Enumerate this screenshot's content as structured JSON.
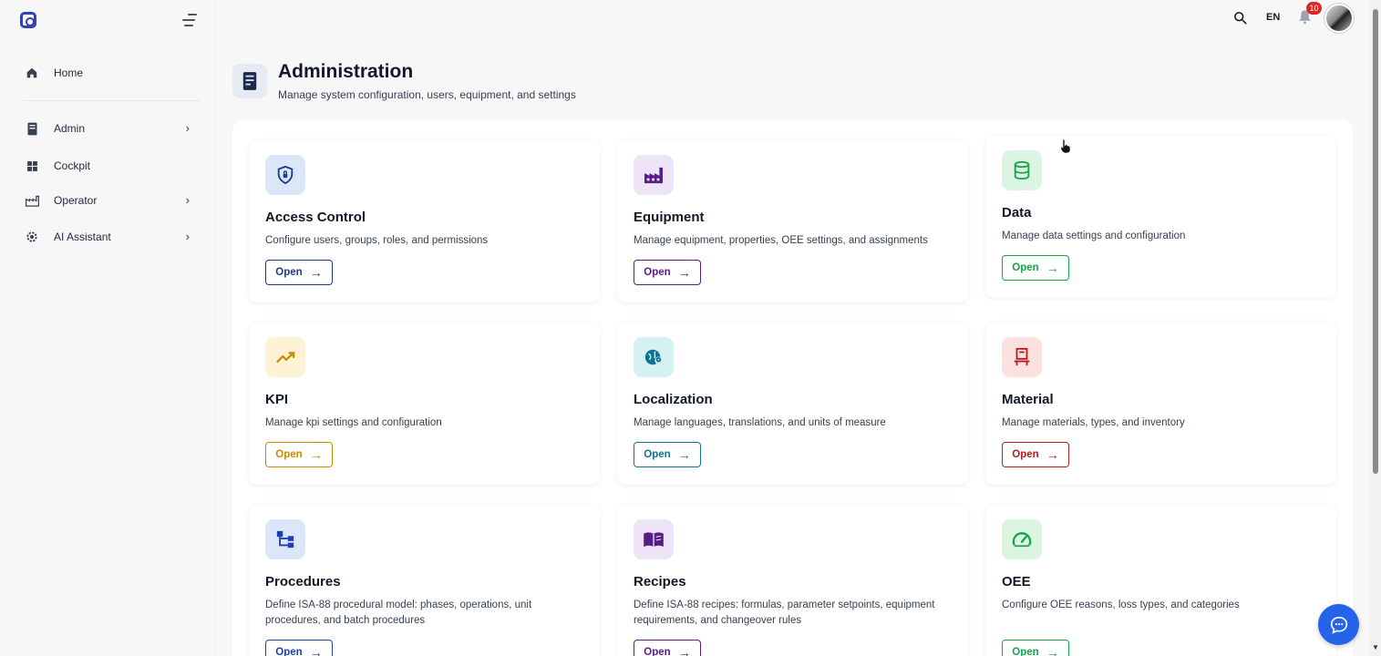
{
  "sidebar": {
    "items": [
      {
        "label": "Home",
        "icon": "home-icon"
      },
      {
        "label": "Admin",
        "icon": "admin-doc-icon",
        "has_children": true
      },
      {
        "label": "Cockpit",
        "icon": "dashboard-icon"
      },
      {
        "label": "Operator",
        "icon": "factory-icon",
        "has_children": true
      },
      {
        "label": "AI Assistant",
        "icon": "gear-icon",
        "has_children": true
      }
    ]
  },
  "topbar": {
    "language": "EN",
    "notifications_count": "10"
  },
  "page": {
    "title": "Administration",
    "subtitle": "Manage system configuration, users, equipment, and settings"
  },
  "cards": [
    {
      "title": "Access Control",
      "description": "Configure users, groups, roles, and permissions",
      "button": "Open",
      "color": "#1e3a8a",
      "bg": "#dbe7f8",
      "icon": "shield-lock-icon"
    },
    {
      "title": "Equipment",
      "description": "Manage equipment, properties, OEE settings, and assignments",
      "button": "Open",
      "color": "#581c87",
      "bg": "#ede4f7",
      "icon": "factory-icon"
    },
    {
      "title": "Data",
      "description": "Manage data settings and configuration",
      "button": "Open",
      "color": "#16a34a",
      "bg": "#dcf5e3",
      "icon": "database-icon"
    },
    {
      "title": "KPI",
      "description": "Manage kpi settings and configuration",
      "button": "Open",
      "color": "#ca8a04",
      "bg": "#fdf3d4",
      "icon": "trending-up-icon"
    },
    {
      "title": "Localization",
      "description": "Manage languages, translations, and units of measure",
      "button": "Open",
      "color": "#0e7490",
      "bg": "#d6f1f4",
      "icon": "globe-location-icon"
    },
    {
      "title": "Material",
      "description": "Manage materials, types, and inventory",
      "button": "Open",
      "color": "#b91c1c",
      "bg": "#fbe2e0",
      "icon": "material-cart-icon"
    },
    {
      "title": "Procedures",
      "description": "Define ISA-88 procedural model: phases, operations, unit procedures, and batch procedures",
      "button": "Open",
      "color": "#1e40af",
      "bg": "#dbe7f8",
      "icon": "hierarchy-icon"
    },
    {
      "title": "Recipes",
      "description": "Define ISA-88 recipes: formulas, parameter setpoints, equipment requirements, and changeover rules",
      "button": "Open",
      "color": "#581c87",
      "bg": "#ede4f7",
      "icon": "open-book-icon"
    },
    {
      "title": "OEE",
      "description": "Configure OEE reasons, loss types, and categories",
      "button": "Open",
      "color": "#16a34a",
      "bg": "#dcf5e3",
      "icon": "gauge-icon"
    }
  ]
}
